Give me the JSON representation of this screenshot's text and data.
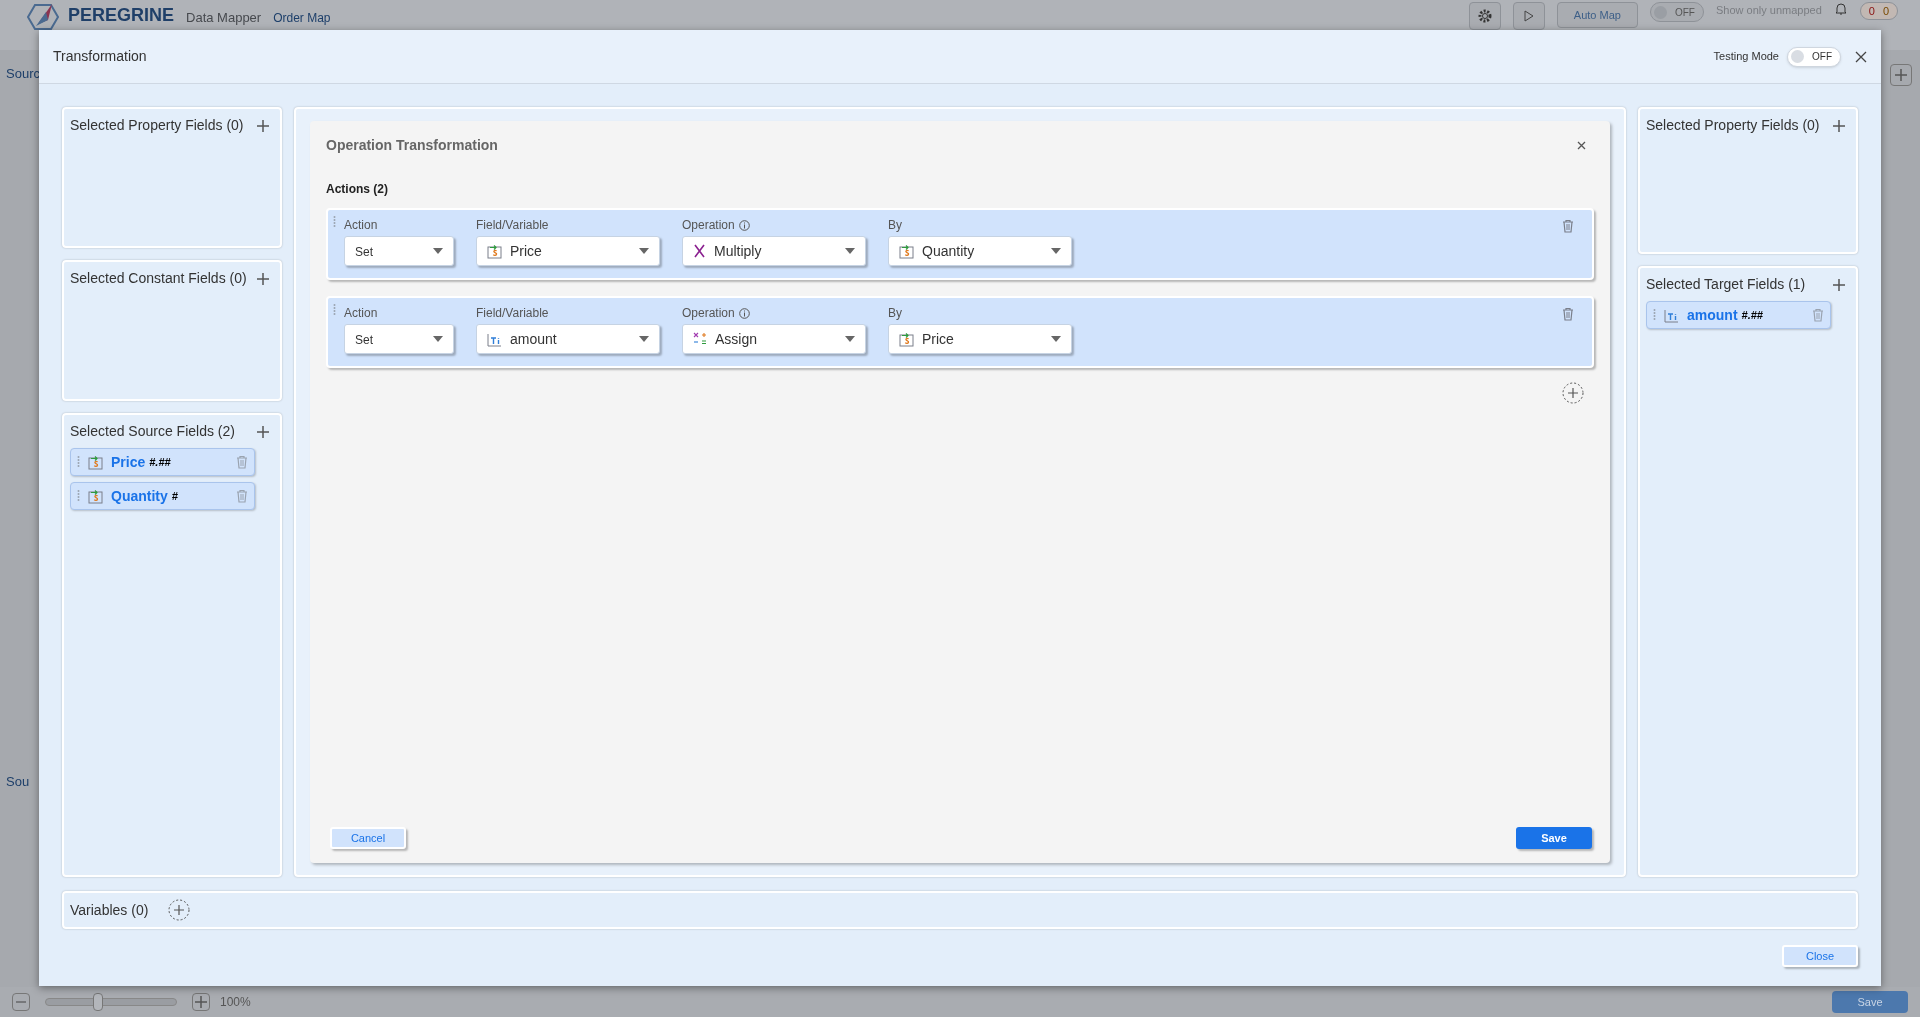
{
  "app": {
    "logo": "PEREGRINE",
    "subtitle": "Data Mapper",
    "map_name": "Order Map",
    "auto_map": "Auto Map",
    "unmapped_toggle": {
      "label": "OFF",
      "on": false
    },
    "unmapped_label": "Show only unmapped",
    "badges": [
      "0",
      "0"
    ],
    "side_labels": [
      "Sourc",
      "Sou"
    ],
    "zoom": {
      "level": 0.4,
      "reading": "100%"
    },
    "save": "Save"
  },
  "dialog": {
    "title": "Transformation",
    "testing_mode": {
      "label": "Testing Mode",
      "toggle": "OFF",
      "on": false
    },
    "left_panels": [
      {
        "title": "Selected Property Fields (0)"
      },
      {
        "title": "Selected Constant Fields (0)"
      },
      {
        "title": "Selected Source Fields (2)",
        "fields": [
          {
            "name": "Price",
            "format": "#.##",
            "kind": "currency"
          },
          {
            "name": "Quantity",
            "format": "#",
            "kind": "currency"
          }
        ]
      }
    ],
    "operation": {
      "title": "Operation Transformation",
      "actions_label": "Actions (2)",
      "actions": [
        {
          "labels": [
            "Action",
            "Field/Variable",
            "Operation",
            "By"
          ],
          "action": "Set",
          "field": {
            "name": "Price",
            "kind": "currency"
          },
          "operation": {
            "name": "Multiply",
            "kind": "multiply"
          },
          "by": {
            "name": "Quantity",
            "kind": "currency"
          }
        },
        {
          "labels": [
            "Action",
            "Field/Variable",
            "Operation",
            "By"
          ],
          "action": "Set",
          "field": {
            "name": "amount",
            "kind": "text"
          },
          "operation": {
            "name": "Assign",
            "kind": "assign"
          },
          "by": {
            "name": "Price",
            "kind": "currency"
          }
        }
      ],
      "cancel": "Cancel",
      "save": "Save"
    },
    "right_panels": [
      {
        "title": "Selected Property Fields (0)"
      },
      {
        "title": "Selected Target Fields (1)",
        "fields": [
          {
            "name": "amount",
            "format": "#.##",
            "kind": "text"
          }
        ]
      }
    ],
    "variables": "Variables (0)",
    "close": "Close"
  }
}
